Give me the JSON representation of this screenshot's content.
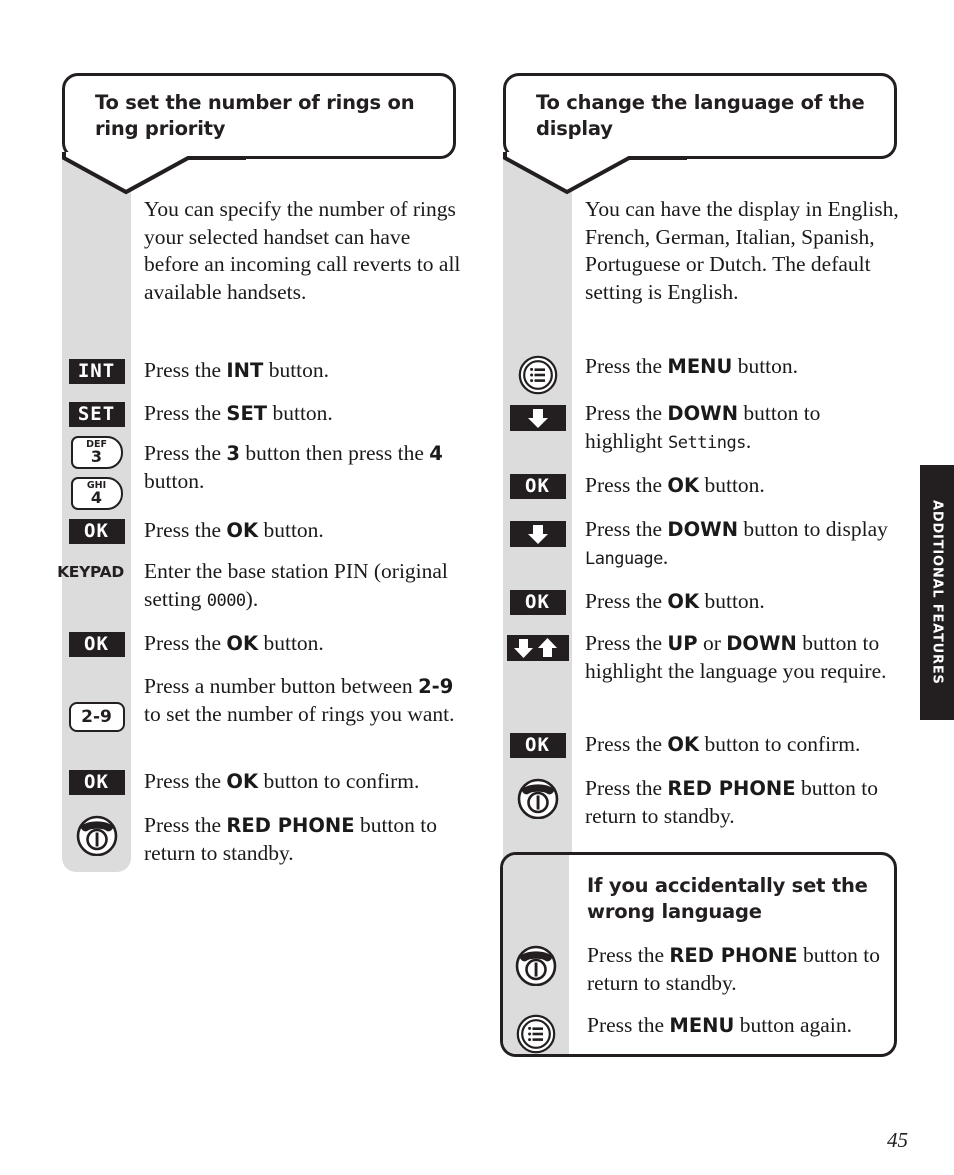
{
  "page": {
    "number": "45",
    "side_tab": "ADDITIONAL FEATURES"
  },
  "left_column": {
    "callout_title": "To set the number of rings on ring priority",
    "intro": "You can specify the number of rings your selected handset can have before an incoming call reverts to all available handsets.",
    "steps": [
      {
        "icon": "int-key-icon",
        "icon_label": "INT",
        "text_html": "Press the <b class=\"b\">INT</b> button."
      },
      {
        "icon": "set-key-icon",
        "icon_label": "SET",
        "text_html": "Press the <b class=\"b\">SET</b> button."
      },
      {
        "icon": "number-key-3-icon",
        "icon_label": "3",
        "icon_sub": "DEF",
        "text_html": "Press the <b class=\"b\">3</b> button then press the <b class=\"b\">4</b> button."
      },
      {
        "icon": "number-key-4-icon",
        "icon_label": "4",
        "icon_sub": "GHI",
        "text_html": ""
      },
      {
        "icon": "ok-key-icon",
        "icon_label": "OK",
        "text_html": "Press the <b class=\"b\">OK</b> button."
      },
      {
        "icon": "keypad-icon",
        "icon_label": "KEYPAD",
        "text_html": "Enter the base station PIN (original setting <span class=\"lcd\">0000</span>)."
      },
      {
        "icon": "ok-key-icon",
        "icon_label": "OK",
        "text_html": "Press the <b class=\"b\">OK</b> button."
      },
      {
        "icon": "number-range-2-9-icon",
        "icon_label": "2-9",
        "text_html": "Press a number button between <b class=\"b\">2-9</b> to set the number of rings you want."
      },
      {
        "icon": "ok-key-icon",
        "icon_label": "OK",
        "text_html": "Press the <b class=\"b\">OK</b> button to confirm."
      },
      {
        "icon": "red-phone-icon",
        "icon_label": "",
        "text_html": "Press the <b class=\"b\">RED PHONE</b> button to return to standby."
      }
    ]
  },
  "right_column": {
    "callout_title": "To change the language of the display",
    "intro": "You can have the display in English, French, German, Italian, Spanish, Portuguese or Dutch. The default setting is English.",
    "steps": [
      {
        "icon": "menu-button-icon",
        "icon_label": "",
        "text_html": "Press the <b class=\"b\">MENU</b> button."
      },
      {
        "icon": "down-arrow-icon",
        "icon_label": "",
        "text_html": "Press the <b class=\"b\">DOWN</b> button to highlight <span class=\"lcd\">Settings</span>."
      },
      {
        "icon": "ok-key-icon",
        "icon_label": "OK",
        "text_html": "Press the <b class=\"b\">OK</b> button."
      },
      {
        "icon": "down-arrow-icon",
        "icon_label": "",
        "text_html": "Press the <b class=\"b\">DOWN</b> button to display <span class=\"lcd\">Language</span>."
      },
      {
        "icon": "ok-key-icon",
        "icon_label": "OK",
        "text_html": "Press the <b class=\"b\">OK</b> button."
      },
      {
        "icon": "up-down-arrow-icon",
        "icon_label": "",
        "text_html": "Press the <b class=\"b\">UP</b> or <b class=\"b\">DOWN</b> button to highlight the language you require."
      },
      {
        "icon": "ok-key-icon",
        "icon_label": "OK",
        "text_html": "Press the <b class=\"b\">OK</b> button to confirm."
      },
      {
        "icon": "red-phone-icon",
        "icon_label": "",
        "text_html": "Press the <b class=\"b\">RED PHONE</b> button to return to standby."
      }
    ],
    "note_box": {
      "title": "If you accidentally set the wrong language",
      "steps": [
        {
          "icon": "red-phone-icon",
          "text_html": "Press the <b class=\"b\">RED PHONE</b> button to return to standby."
        },
        {
          "icon": "menu-button-icon",
          "text_html": "Press the <b class=\"b\">MENU</b> button again."
        }
      ]
    }
  },
  "colors": {
    "ink": "#231f20",
    "rail_grey": "#dcdcdc",
    "paper": "#ffffff"
  }
}
